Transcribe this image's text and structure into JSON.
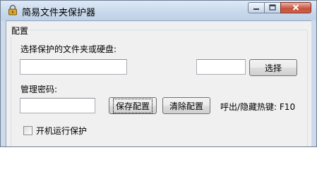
{
  "window": {
    "title": "简易文件夹保护器"
  },
  "group": {
    "label": "配置"
  },
  "folder": {
    "label": "选择保护的文件夹或硬盘:",
    "path_value": "",
    "secondary_value": "",
    "browse_button": "选择"
  },
  "password": {
    "label": "管理密码:",
    "value": "",
    "save_button": "保存配置",
    "clear_button": "清除配置",
    "hotkey_text": "呼出/隐藏热键: F10"
  },
  "startup": {
    "label": "开机运行保护",
    "checked": false
  },
  "icons": {
    "app": "lock-icon",
    "minimize": "minimize-icon",
    "maximize": "maximize-icon",
    "close": "close-icon"
  }
}
